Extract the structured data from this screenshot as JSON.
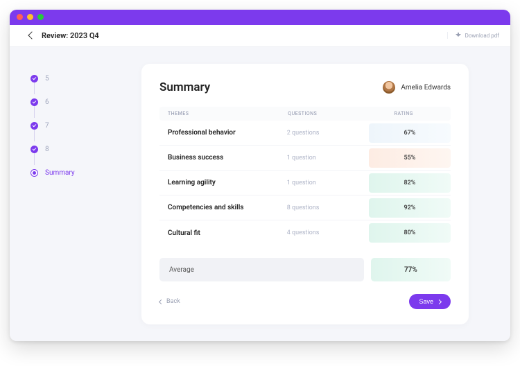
{
  "header": {
    "title": "Review: 2023 Q4",
    "download_label": "Download pdf"
  },
  "sidebar": {
    "steps": [
      {
        "label": "5",
        "state": "done"
      },
      {
        "label": "6",
        "state": "done"
      },
      {
        "label": "7",
        "state": "done"
      },
      {
        "label": "8",
        "state": "done"
      },
      {
        "label": "Summary",
        "state": "current"
      }
    ]
  },
  "summary": {
    "title": "Summary",
    "user_name": "Amelia Edwards",
    "columns": {
      "themes": "THEMES",
      "questions": "QUESTIONS",
      "rating": "RATING"
    },
    "rows": [
      {
        "theme": "Professional behavior",
        "questions": "2 questions",
        "rating": "67%",
        "tint": "blue"
      },
      {
        "theme": "Business success",
        "questions": "1 question",
        "rating": "55%",
        "tint": "peach"
      },
      {
        "theme": "Learning agility",
        "questions": "1 question",
        "rating": "82%",
        "tint": "mint"
      },
      {
        "theme": "Competencies and skills",
        "questions": "8 questions",
        "rating": "92%",
        "tint": "mint"
      },
      {
        "theme": "Cultural fit",
        "questions": "4 questions",
        "rating": "80%",
        "tint": "mint"
      }
    ],
    "average": {
      "label": "Average",
      "value": "77%",
      "tint": "mint"
    },
    "back_label": "Back",
    "save_label": "Save"
  },
  "colors": {
    "accent": "#7c3aed"
  }
}
